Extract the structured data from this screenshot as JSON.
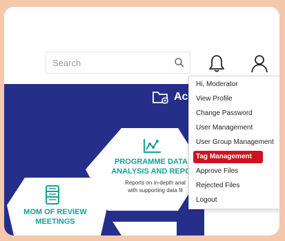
{
  "header": {
    "search_placeholder": "Search"
  },
  "banner": {
    "title": "Ac"
  },
  "cards": {
    "programme": {
      "title": "PROGRAMME DATA\nANALYSIS AND REPO",
      "description": "Reports on in-depth anal\nwith supporting data fil"
    },
    "mom": {
      "title": "MOM OF REVIEW\nMEETINGS"
    }
  },
  "user_menu": {
    "items": [
      {
        "label": "Hi, Moderator"
      },
      {
        "label": "View Profile"
      },
      {
        "label": "Change Password"
      },
      {
        "label": "User Management"
      },
      {
        "label": "User Group Management"
      },
      {
        "label": "Tag Management"
      },
      {
        "label": "Approve Files"
      },
      {
        "label": "Rejected Files"
      },
      {
        "label": "Logout"
      }
    ],
    "active_index": 5
  },
  "colors": {
    "outer_bg": "#f6c8ab",
    "banner": "#252f8a",
    "teal": "#179e98",
    "active": "#d0111f"
  },
  "icons": [
    "search-icon",
    "bell-icon",
    "user-icon",
    "folder-gear-icon",
    "chart-icon",
    "server-icon"
  ]
}
